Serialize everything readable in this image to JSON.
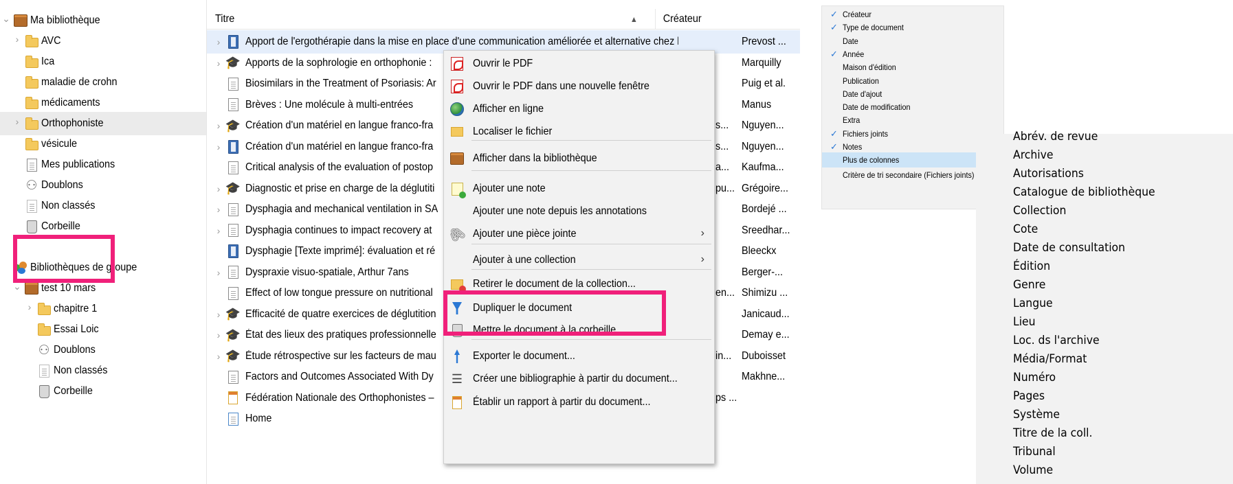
{
  "tree": {
    "items": [
      {
        "label": "Ma bibliothèque",
        "icon": "library-icon",
        "chevron": "expanded"
      },
      {
        "label": "AVC",
        "icon": "folder-icon",
        "chevron": "collapsed"
      },
      {
        "label": "Ica",
        "icon": "folder-icon",
        "chevron": ""
      },
      {
        "label": "maladie de crohn",
        "icon": "folder-icon",
        "chevron": ""
      },
      {
        "label": "médicaments",
        "icon": "folder-icon",
        "chevron": ""
      },
      {
        "label": "Orthophoniste",
        "icon": "folder-icon",
        "chevron": "collapsed",
        "selected": true
      },
      {
        "label": "vésicule",
        "icon": "folder-icon",
        "chevron": ""
      },
      {
        "label": "Mes publications",
        "icon": "document-icon",
        "chevron": ""
      },
      {
        "label": "Doublons",
        "icon": "duplicates-icon",
        "chevron": ""
      },
      {
        "label": "Non classés",
        "icon": "unfiled-icon",
        "chevron": ""
      },
      {
        "label": "Corbeille",
        "icon": "trash-icon",
        "chevron": ""
      },
      {
        "label": "Bibliothèques de groupe",
        "icon": "group-icon",
        "chevron": ""
      },
      {
        "label": "test 10 mars",
        "icon": "library-icon",
        "chevron": "expanded"
      },
      {
        "label": "chapitre 1",
        "icon": "folder-icon",
        "chevron": "collapsed"
      },
      {
        "label": "Essai Loic",
        "icon": "folder-icon",
        "chevron": ""
      },
      {
        "label": "Doublons",
        "icon": "duplicates-icon",
        "chevron": ""
      },
      {
        "label": "Non classés",
        "icon": "unfiled-icon",
        "chevron": ""
      },
      {
        "label": "Corbeille",
        "icon": "trash-icon",
        "chevron": ""
      }
    ]
  },
  "list": {
    "headers": {
      "title": "Titre",
      "sort": "▲",
      "creator": "Créateur"
    },
    "rows": [
      {
        "title": "Apport de l'ergothérapie dans la mise en place d'une communication améliorée et alternative chez les pa...",
        "creator": "Prevost ...",
        "icon": "book-icon",
        "chevron": true,
        "selected": true
      },
      {
        "title": "Apports de la sophrologie en orthophonie :",
        "creator": "Marquilly",
        "icon": "thesis-icon",
        "chevron": true
      },
      {
        "title": "Biosimilars in the Treatment of Psoriasis: Ar",
        "creator": "Puig et al.",
        "icon": "document-icon",
        "chevron": false
      },
      {
        "title": "Brèves : Une molécule à multi-entrées",
        "creator": "Manus",
        "icon": "document-icon",
        "chevron": false
      },
      {
        "title": "Création d'un matériel en langue franco-fra",
        "tail": "s...",
        "creator": "Nguyen...",
        "icon": "thesis-icon",
        "chevron": true
      },
      {
        "title": "Création d'un matériel en langue franco-fra",
        "tail": "s...",
        "creator": "Nguyen...",
        "icon": "book-icon",
        "chevron": true
      },
      {
        "title": "Critical analysis of the evaluation of postop",
        "tail": "a...",
        "creator": "Kaufma...",
        "icon": "document-icon",
        "chevron": false
      },
      {
        "title": "Diagnostic et prise en charge de la déglutiti",
        "tail": "pu...",
        "creator": "Grégoire...",
        "icon": "thesis-icon",
        "chevron": true
      },
      {
        "title": "Dysphagia and mechanical ventilation in SA",
        "creator": "Bordejé ...",
        "icon": "document-icon",
        "chevron": true
      },
      {
        "title": "Dysphagia continues to impact recovery at",
        "creator": "Sreedhar...",
        "icon": "document-icon",
        "chevron": true
      },
      {
        "title": "Dysphagie [Texte imprimé]: évaluation et ré",
        "creator": "Bleeckx",
        "icon": "book-icon",
        "chevron": false
      },
      {
        "title": "Dyspraxie visuo-spatiale, Arthur 7ans",
        "creator": "Berger-...",
        "icon": "document-icon",
        "chevron": true
      },
      {
        "title": "Effect of low tongue pressure on nutritional",
        "tail": "en...",
        "creator": "Shimizu ...",
        "icon": "document-icon",
        "chevron": false
      },
      {
        "title": "Efficacité de quatre exercices de déglutition",
        "creator": "Janicaud...",
        "icon": "thesis-icon",
        "chevron": true
      },
      {
        "title": "État des lieux des pratiques professionnelle",
        "creator": "Demay e...",
        "icon": "thesis-icon",
        "chevron": true
      },
      {
        "title": "Étude rétrospective sur les facteurs de mau",
        "tail": "in...",
        "creator": "Duboisset",
        "icon": "thesis-icon",
        "chevron": true
      },
      {
        "title": "Factors and Outcomes Associated With Dy",
        "creator": "Makhne...",
        "icon": "document-icon",
        "chevron": false
      },
      {
        "title": "Fédération Nationale des Orthophonistes –",
        "tail": "ps ...",
        "creator": "",
        "icon": "report-icon",
        "chevron": false
      },
      {
        "title": "Home",
        "creator": "",
        "icon": "webpage-icon",
        "chevron": false
      }
    ]
  },
  "context_menu": {
    "items": [
      {
        "label": "Ouvrir le PDF",
        "icon": "pdf-icon"
      },
      {
        "label": "Ouvrir le PDF dans une nouvelle fenêtre",
        "icon": "pdf-icon"
      },
      {
        "label": "Afficher en ligne",
        "icon": "globe-icon"
      },
      {
        "label": "Localiser le fichier",
        "icon": "locate-folder-icon"
      },
      {
        "label": "Afficher dans la bibliothèque",
        "icon": "library-icon"
      },
      {
        "label": "Ajouter une note",
        "icon": "add-note-icon"
      },
      {
        "label": "Ajouter une note depuis les annotations",
        "icon": ""
      },
      {
        "label": "Ajouter une pièce jointe",
        "icon": "paperclip-icon",
        "submenu": true
      },
      {
        "label": "Ajouter à une collection",
        "icon": "",
        "submenu": true
      },
      {
        "label": "Retirer le document de la collection...",
        "icon": "remove-folder-icon"
      },
      {
        "label": "Dupliquer le document",
        "icon": "duplicate-icon"
      },
      {
        "label": "Mettre le document à la corbeille...",
        "icon": "trash-icon"
      },
      {
        "label": "Exporter le document...",
        "icon": "export-icon"
      },
      {
        "label": "Créer une bibliographie à partir du document...",
        "icon": "bibliography-icon"
      },
      {
        "label": "Établir un rapport à partir du document...",
        "icon": "report-icon"
      }
    ],
    "submenu_arrow": "›"
  },
  "column_menu": {
    "items": [
      {
        "label": "Créateur",
        "checked": true
      },
      {
        "label": "Type de document",
        "checked": true
      },
      {
        "label": "Date",
        "checked": false
      },
      {
        "label": "Année",
        "checked": true
      },
      {
        "label": "Maison d'édition",
        "checked": false
      },
      {
        "label": "Publication",
        "checked": false
      },
      {
        "label": "Date d'ajout",
        "checked": false
      },
      {
        "label": "Date de modification",
        "checked": false
      },
      {
        "label": "Extra",
        "checked": false
      },
      {
        "label": "Fichiers joints",
        "checked": true
      },
      {
        "label": "Notes",
        "checked": true
      },
      {
        "label": "Plus de colonnes",
        "checked": false,
        "submenu": true,
        "highlighted": true
      },
      {
        "label": "Critère de tri secondaire (Fichiers joints)",
        "checked": false,
        "submenu": true
      }
    ],
    "check_glyph": "✓",
    "submenu_arrow": "›"
  },
  "more_columns": {
    "items": [
      "Abrév. de revue",
      "Archive",
      "Autorisations",
      "Catalogue de bibliothèque",
      "Collection",
      "Cote",
      "Date de consultation",
      "Édition",
      "Genre",
      "Langue",
      "Lieu",
      "Loc. ds l'archive",
      "Média/Format",
      "Numéro",
      "Pages",
      "Système",
      "Titre de la coll.",
      "Tribunal",
      "Volume"
    ]
  },
  "colors": {
    "highlight_box": "#f0207a",
    "selection": "#e5eefb",
    "menu_bg": "#f2f2f2",
    "menu_hover": "#cce4f7"
  }
}
